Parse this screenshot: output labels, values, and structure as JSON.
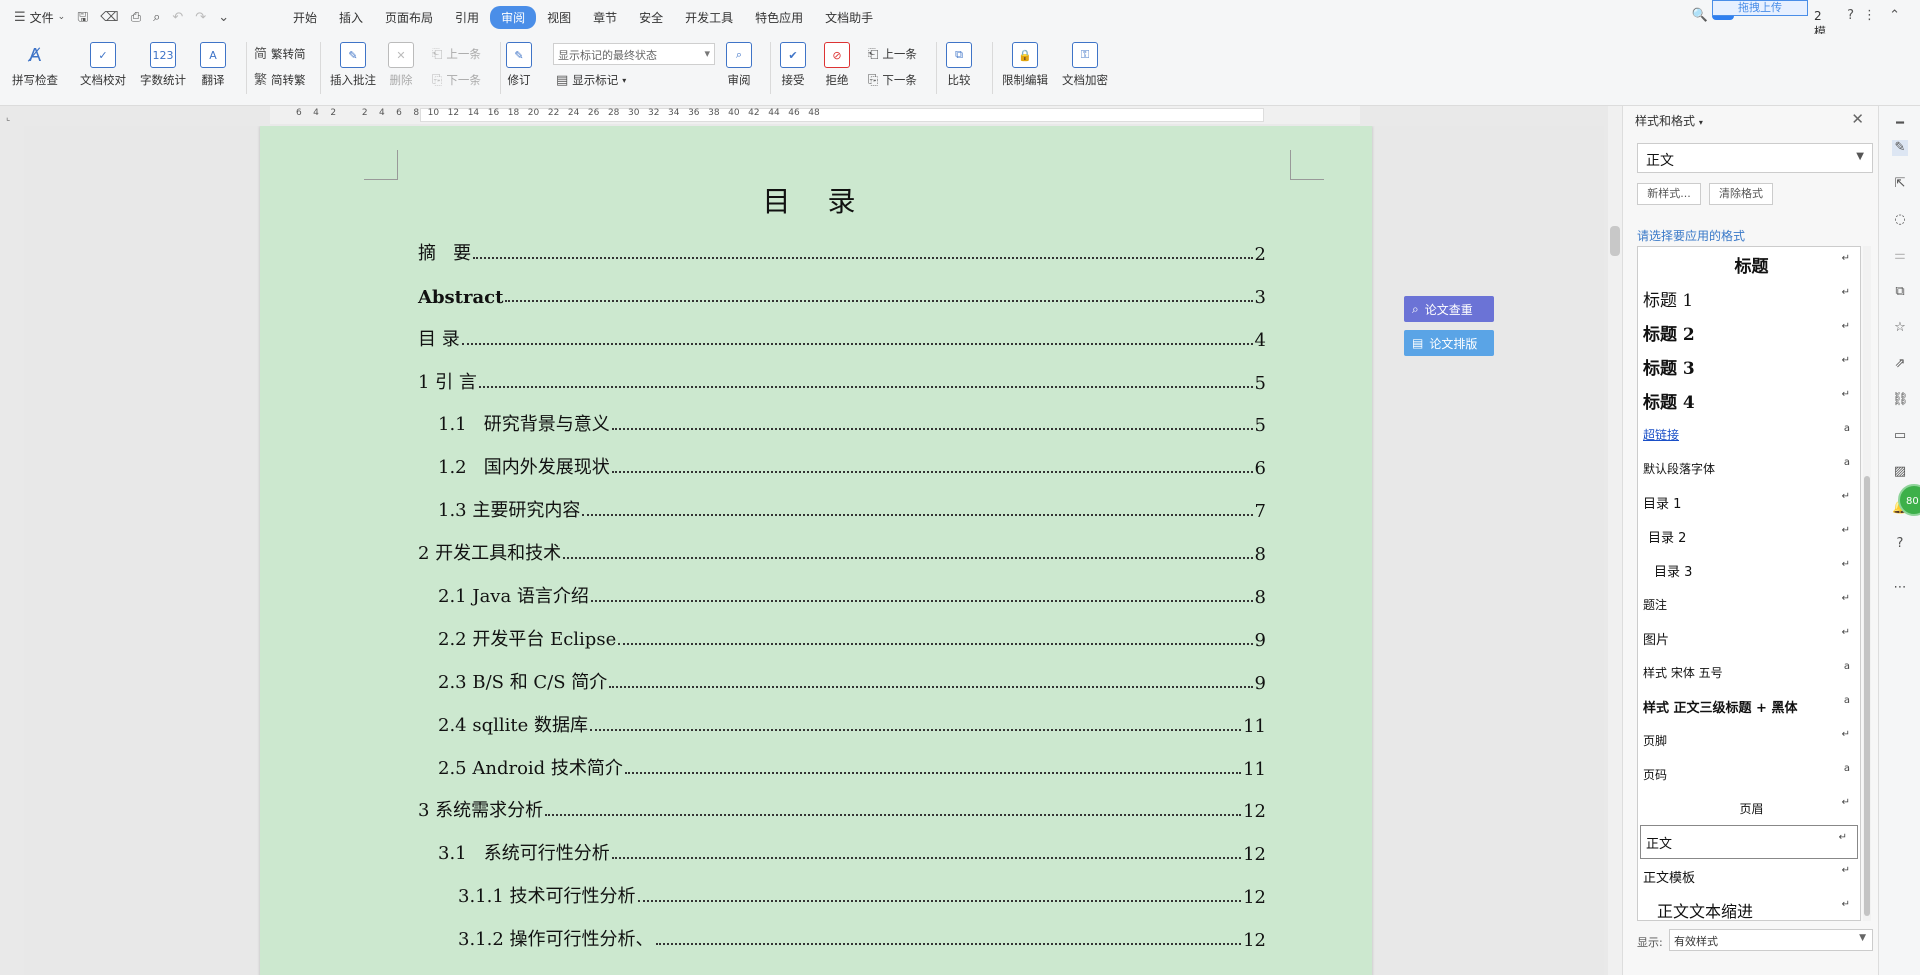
{
  "menubar": {
    "file_label": "文件",
    "tabs": [
      "开始",
      "插入",
      "页面布局",
      "引用",
      "审阅",
      "视图",
      "章节",
      "安全",
      "开发工具",
      "特色应用",
      "文档助手"
    ],
    "active_tab": "审阅",
    "upload_label": "拖拽上传",
    "right_text": "2 模板"
  },
  "toolbar": {
    "spellcheck": "拼写检查",
    "doc_proof": "文档校对",
    "word_count": "字数统计",
    "translate": "翻译",
    "trad_to_simp": "繁转简",
    "simp_to_trad": "简转繁",
    "insert_comment": "插入批注",
    "delete": "删除",
    "prev_comment": "上一条",
    "next_comment": "下一条",
    "track_changes": "修订",
    "markup_select": "显示标记的最终状态",
    "show_markup": "显示标记",
    "review": "审阅",
    "accept": "接受",
    "reject": "拒绝",
    "prev_change": "上一条",
    "next_change": "下一条",
    "compare": "比较",
    "restrict_edit": "限制编辑",
    "encrypt": "文档加密"
  },
  "ruler": {
    "numbers": "6    4    2         2    4    6    8   10   12   14   16   18   20   22   24   26   28   30   32   34   36   38   40   42   44   46   48"
  },
  "document": {
    "title": "目 录",
    "toc": [
      {
        "text": "摘   要",
        "page": "2",
        "level": 1
      },
      {
        "text": "Abstract",
        "page": "3",
        "level": 1,
        "bold": true
      },
      {
        "text": "目 录",
        "page": "4",
        "level": 1
      },
      {
        "text": "1 引 言",
        "page": "5",
        "level": 1
      },
      {
        "text": "1.1   研究背景与意义",
        "page": "5",
        "level": 2
      },
      {
        "text": "1.2   国内外发展现状",
        "page": "6",
        "level": 2
      },
      {
        "text": "1.3 主要研究内容",
        "page": "7",
        "level": 2
      },
      {
        "text": "2 开发工具和技术",
        "page": "8",
        "level": 1
      },
      {
        "text": "2.1 Java 语言介绍",
        "page": "8",
        "level": 2
      },
      {
        "text": "2.2 开发平台 Eclipse",
        "page": "9",
        "level": 2
      },
      {
        "text": "2.3 B/S 和 C/S 简介",
        "page": "9",
        "level": 2
      },
      {
        "text": "2.4 sqllite 数据库",
        "page": "11",
        "level": 2
      },
      {
        "text": "2.5 Android 技术简介",
        "page": "11",
        "level": 2
      },
      {
        "text": "3 系统需求分析",
        "page": "12",
        "level": 1
      },
      {
        "text": "3.1   系统可行性分析",
        "page": "12",
        "level": 2
      },
      {
        "text": "3.1.1 技术可行性分析",
        "page": "12",
        "level": 3
      },
      {
        "text": "3.1.2 操作可行性分析、",
        "page": "12",
        "level": 3
      }
    ],
    "float_check": "论文查重",
    "float_format": "论文排版"
  },
  "pane": {
    "title": "样式和格式",
    "current_style": "正文",
    "new_style": "新样式...",
    "clear_format": "清除格式",
    "hint": "请选择要应用的格式",
    "styles": [
      {
        "name": "标题",
        "mark": "↵",
        "size": 17,
        "bold": true,
        "center": true
      },
      {
        "name": "标题 1",
        "mark": "↵",
        "size": 17,
        "bold": false
      },
      {
        "name": "标题 2",
        "mark": "↵",
        "size": 17,
        "bold": true
      },
      {
        "name": "标题 3",
        "mark": "↵",
        "size": 17,
        "bold": true
      },
      {
        "name": "标题 4",
        "mark": "↵",
        "size": 17,
        "bold": true
      },
      {
        "name": "超链接",
        "mark": "a",
        "size": 12,
        "link": true
      },
      {
        "name": "默认段落字体",
        "mark": "a",
        "size": 12
      },
      {
        "name": "目录 1",
        "mark": "↵",
        "size": 13
      },
      {
        "name": "目录 2",
        "mark": "↵",
        "size": 13,
        "indent": 5
      },
      {
        "name": "目录 3",
        "mark": "↵",
        "size": 13,
        "indent": 11
      },
      {
        "name": "题注",
        "mark": "↵",
        "size": 12
      },
      {
        "name": "图片",
        "mark": "↵",
        "size": 13
      },
      {
        "name": "样式 宋体 五号",
        "mark": "a",
        "size": 12
      },
      {
        "name": "样式 正文三级标题 + 黑体",
        "mark": "a",
        "size": 13,
        "bold": true
      },
      {
        "name": "页脚",
        "mark": "↵",
        "size": 12
      },
      {
        "name": "页码",
        "mark": "a",
        "size": 12
      },
      {
        "name": "页眉",
        "mark": "↵",
        "size": 12,
        "center": true
      },
      {
        "name": "正文",
        "mark": "↵",
        "size": 13,
        "selected": true
      },
      {
        "name": "正文模板",
        "mark": "↵",
        "size": 13
      },
      {
        "name": "正文文本缩进",
        "mark": "↵",
        "size": 16,
        "indent": 14
      }
    ],
    "show_label": "显示:",
    "show_value": "有效样式"
  },
  "badge": "80",
  "colors": {
    "accent": "#4a8ee8",
    "page_bg": "#cce8cf",
    "float_check_bg": "#6b73d6",
    "float_format_bg": "#5aa4e6",
    "link": "#1a4fc7"
  }
}
